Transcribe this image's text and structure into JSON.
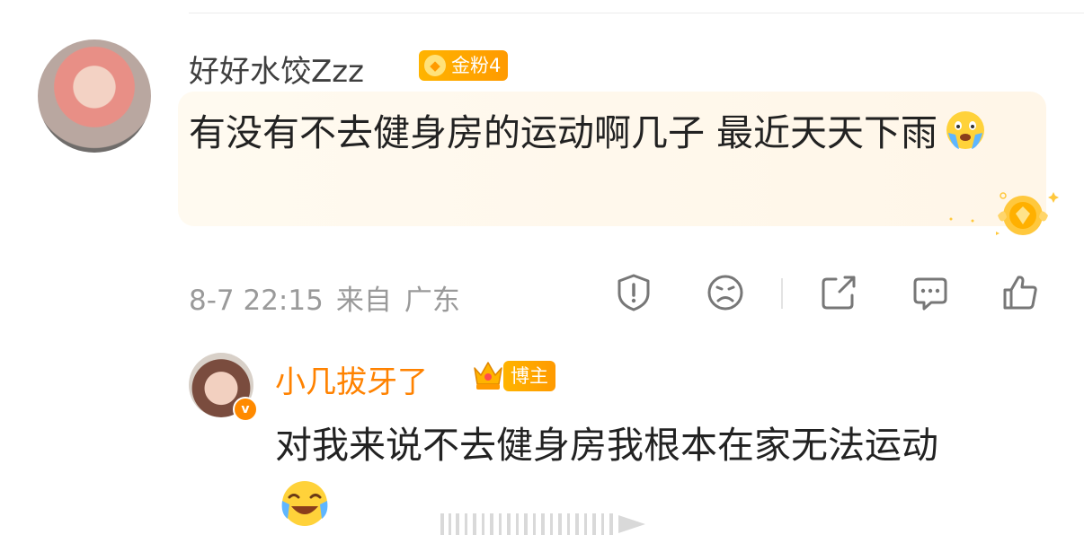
{
  "comment": {
    "username": "好好水饺Zzz",
    "fan_badge": "金粉4",
    "text": "有没有不去健身房的运动啊几子 最近天天下雨",
    "date": "8-7 22:15",
    "source_prefix": "来自",
    "source": "广东"
  },
  "actions": [
    "report-icon",
    "dislike-icon",
    "share-icon",
    "comment-icon",
    "like-icon"
  ],
  "reply": {
    "username": "小几拔牙了",
    "role_badge": "博主",
    "text": "对我来说不去健身房我根本在家无法运动"
  },
  "colors": {
    "badge": "#ffa800",
    "reply_name": "#ff8200",
    "meta": "#9a9a9a",
    "bubble": "#fff7ea"
  }
}
